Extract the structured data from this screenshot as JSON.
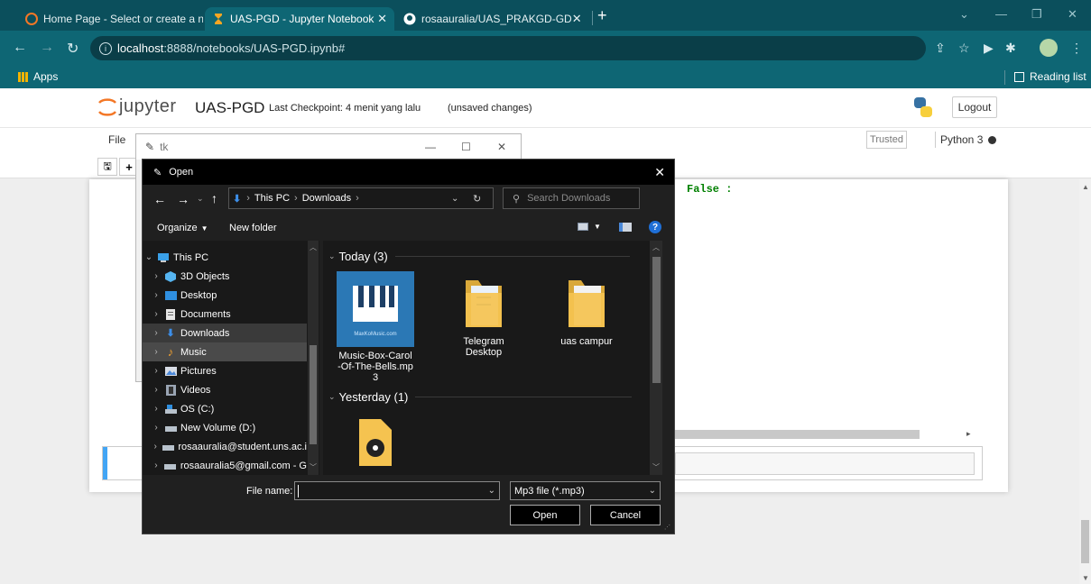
{
  "browser": {
    "tabs": [
      {
        "title": "Home Page - Select or create a n",
        "active": false
      },
      {
        "title": "UAS-PGD - Jupyter Notebook",
        "active": true
      },
      {
        "title": "rosaauralia/UAS_PRAKGD-GD",
        "active": false
      }
    ],
    "new_tab": "+",
    "url_host": "localhost",
    "url_rest": ":8888/notebooks/UAS-PGD.ipynb#",
    "bookmarks_apps": "Apps",
    "reading_list": "Reading list"
  },
  "jupyter": {
    "logo_text": "jupyter",
    "notebook_name": "UAS-PGD",
    "checkpoint": "Last Checkpoint: 4 menit yang lalu",
    "unsaved": "(unsaved changes)",
    "logout": "Logout",
    "menu_file": "File",
    "trusted": "Trusted",
    "kernel": "Python 3",
    "code_fragment": "False :"
  },
  "tk_window": {
    "title": "tk"
  },
  "open_dialog": {
    "title": "Open",
    "breadcrumb": [
      "This PC",
      "Downloads"
    ],
    "search_placeholder": "Search Downloads",
    "organize": "Organize",
    "new_folder": "New folder",
    "tree": [
      {
        "label": "This PC",
        "icon": "pc-icon",
        "expanded": true
      },
      {
        "label": "3D Objects",
        "icon": "cube-icon"
      },
      {
        "label": "Desktop",
        "icon": "desktop-icon"
      },
      {
        "label": "Documents",
        "icon": "document-icon"
      },
      {
        "label": "Downloads",
        "icon": "download-icon",
        "selected": true
      },
      {
        "label": "Music",
        "icon": "music-icon",
        "hover": true
      },
      {
        "label": "Pictures",
        "icon": "pictures-icon"
      },
      {
        "label": "Videos",
        "icon": "video-icon"
      },
      {
        "label": "OS (C:)",
        "icon": "drive-icon"
      },
      {
        "label": "New Volume (D:)",
        "icon": "drive-icon"
      },
      {
        "label": "rosaauralia@student.uns.ac.i",
        "icon": "network-drive-icon"
      },
      {
        "label": "rosaauralia5@gmail.com - G",
        "icon": "network-drive-icon"
      }
    ],
    "groups": [
      {
        "label": "Today (3)"
      },
      {
        "label": "Yesterday (1)"
      }
    ],
    "files": [
      {
        "name_lines": [
          "Music-Box-Carol",
          "-Of-The-Bells.mp",
          "3"
        ],
        "thumb_text": "MaxKoMusic.com"
      },
      {
        "name_lines": [
          "Telegram",
          "Desktop"
        ]
      },
      {
        "name_lines": [
          "uas campur"
        ]
      }
    ],
    "file_name_label": "File name:",
    "file_name_value": "",
    "file_type": "Mp3 file (*.mp3)",
    "open_button": "Open",
    "cancel_button": "Cancel"
  },
  "colors": {
    "browser_dark": "#0b4f5c",
    "browser_tab": "#0e6674",
    "dialog_bg": "#202020",
    "folder_yellow": "#f5c350",
    "jupyter_orange": "#f37726"
  }
}
